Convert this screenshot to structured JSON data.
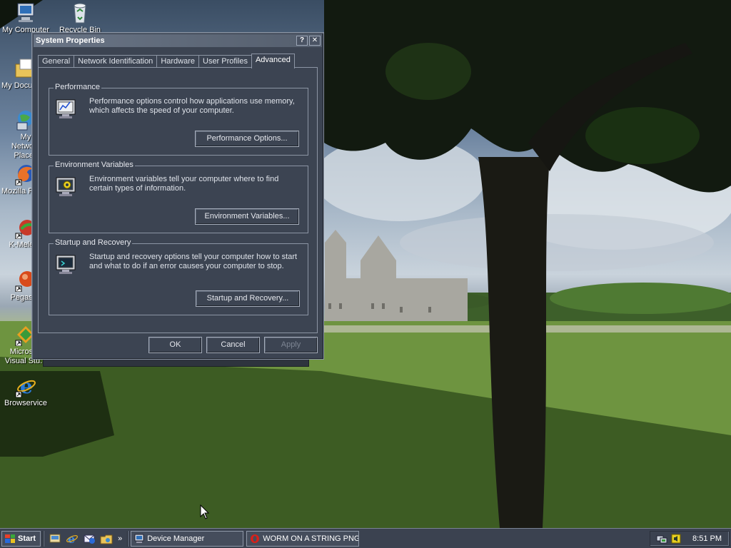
{
  "desktop": {
    "icons": [
      {
        "label": "My Computer"
      },
      {
        "label": "Recycle Bin"
      },
      {
        "label": "My Documents"
      },
      {
        "label": "My Network Places"
      },
      {
        "label": "Mozilla Firefox"
      },
      {
        "label": "K-Meleon"
      },
      {
        "label": "Pegasus"
      },
      {
        "label": "Microsoft Visual Stu..."
      },
      {
        "label": "Browservice"
      }
    ]
  },
  "dialog": {
    "title": "System Properties",
    "help_btn": "?",
    "close_btn": "✕",
    "tabs": [
      {
        "label": "General"
      },
      {
        "label": "Network Identification"
      },
      {
        "label": "Hardware"
      },
      {
        "label": "User Profiles"
      },
      {
        "label": "Advanced"
      }
    ],
    "active_tab": "Advanced",
    "groups": [
      {
        "title": "Performance",
        "text": "Performance options control how applications use memory, which affects the speed of your computer.",
        "button": "Performance Options..."
      },
      {
        "title": "Environment Variables",
        "text": "Environment variables tell your computer where to find certain types of information.",
        "button": "Environment Variables..."
      },
      {
        "title": "Startup and Recovery",
        "text": "Startup and recovery options tell your computer how to start and what to do if an error causes your computer to stop.",
        "button": "Startup and Recovery..."
      }
    ],
    "ok": "OK",
    "cancel": "Cancel",
    "apply": "Apply"
  },
  "taskbar": {
    "start": "Start",
    "quicklaunch_more": "»",
    "tasks": [
      {
        "label": "Device Manager",
        "icon": "computer-icon"
      },
      {
        "label": "WORM ON A STRING PNG...",
        "icon": "opera-icon"
      }
    ],
    "clock": "8:51 PM"
  },
  "colors": {
    "dialog_bg": "#3c4452",
    "titlebar": "#6a7586",
    "taskbar": "#3b4250"
  }
}
